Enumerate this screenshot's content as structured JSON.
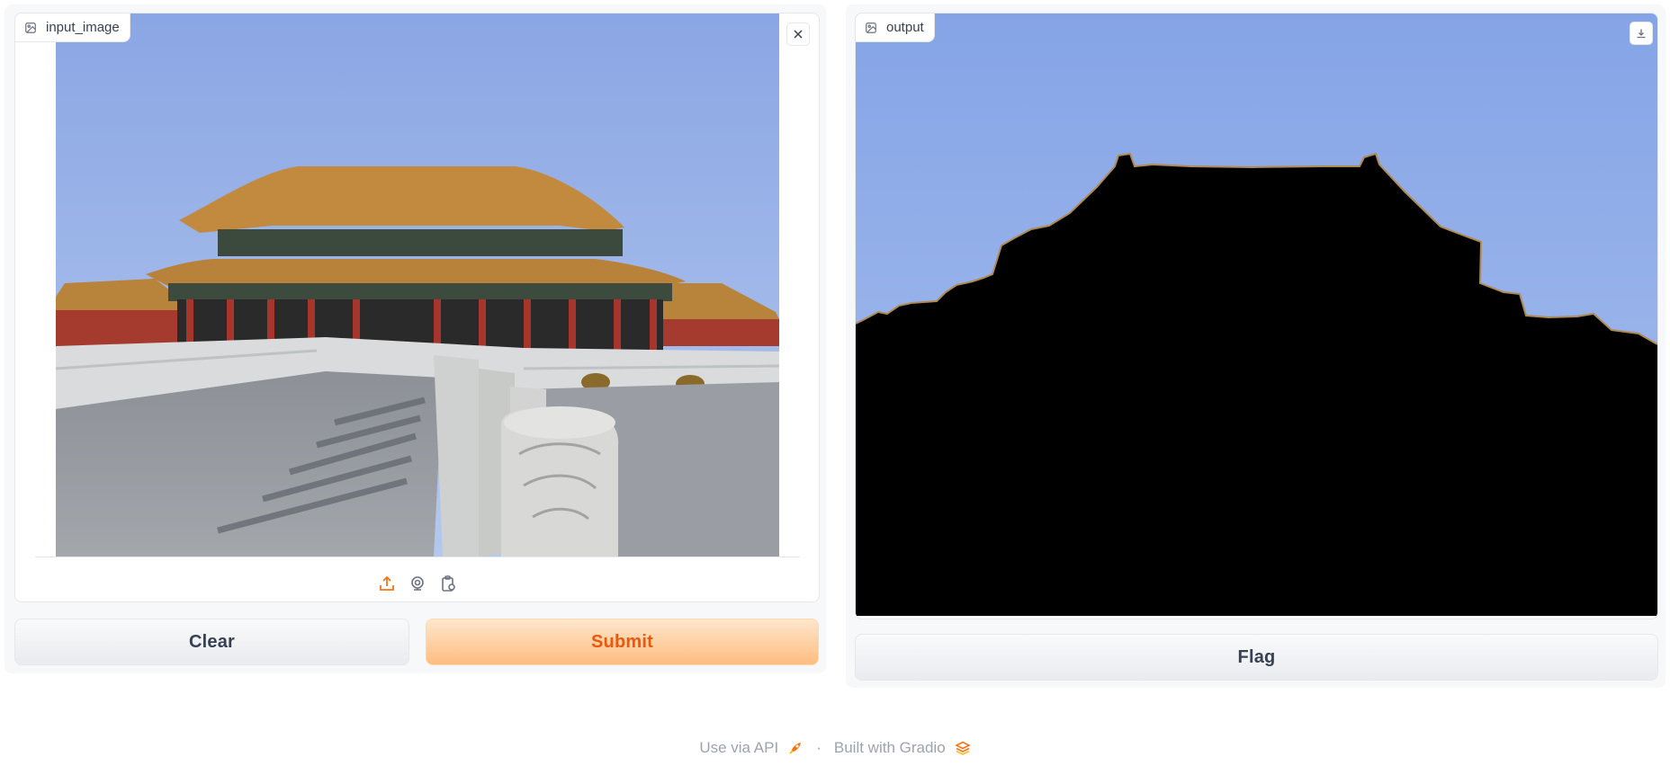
{
  "input": {
    "label": "input_image",
    "sources": [
      "upload",
      "webcam",
      "clipboard"
    ]
  },
  "output": {
    "label": "output"
  },
  "buttons": {
    "clear": "Clear",
    "submit": "Submit",
    "flag": "Flag"
  },
  "footer": {
    "api_link": "Use via API",
    "separator": "·",
    "built_with": "Built with Gradio"
  },
  "colors": {
    "accent": "#f97316",
    "primary_text": "#ea580c",
    "sky": "#8aa8e6",
    "mask": "#000000"
  }
}
